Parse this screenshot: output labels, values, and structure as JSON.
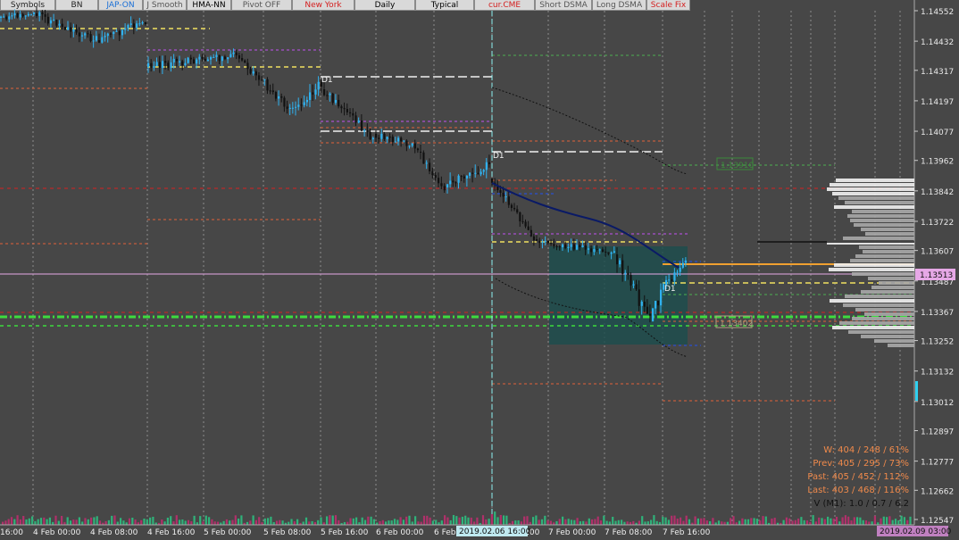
{
  "toolbar": [
    {
      "key": "symbols",
      "label": "Symbols",
      "color": "#222222"
    },
    {
      "key": "bn",
      "label": "BN",
      "color": "#222222"
    },
    {
      "key": "jap_on",
      "label": "JAP-ON",
      "color": "#1a6fd6"
    },
    {
      "key": "j_smooth",
      "label": "J Smooth",
      "color": "#555555"
    },
    {
      "key": "hma_nn",
      "label": "HMA-NN",
      "color": "#000000"
    },
    {
      "key": "pivot_off",
      "label": "Pivot OFF",
      "color": "#555555"
    },
    {
      "key": "new_york",
      "label": "New York",
      "color": "#d42020"
    },
    {
      "key": "daily",
      "label": "Daily",
      "color": "#000000"
    },
    {
      "key": "typical",
      "label": "Typical",
      "color": "#000000"
    },
    {
      "key": "cur_cme",
      "label": "cur.CME",
      "color": "#d42020"
    },
    {
      "key": "short_dsma",
      "label": "Short DSMA",
      "color": "#555555"
    },
    {
      "key": "long_dsma",
      "label": "Long DSMA",
      "color": "#555555"
    },
    {
      "key": "scale_fix",
      "label": "Scale Fix",
      "color": "#d42020"
    }
  ],
  "price_axis": {
    "ticks": [
      "1.14552",
      "1.14432",
      "1.14317",
      "1.14197",
      "1.14077",
      "1.13962",
      "1.13842",
      "1.13722",
      "1.13607",
      "1.13487",
      "1.13367",
      "1.13252",
      "1.13132",
      "1.13012",
      "1.12897",
      "1.12777",
      "1.12662",
      "1.12547"
    ],
    "current_price": "1.13513",
    "label_a": "1.13910",
    "label_b": "1.13402"
  },
  "time_axis": {
    "labels": [
      "16:00",
      "4 Feb 00:00",
      "4 Feb 08:00",
      "4 Feb 16:00",
      "5 Feb 00:00",
      "5 Feb 08:00",
      "5 Feb 16:00",
      "6 Feb 00:00",
      "6 Feb 08:00",
      "6 Feb 16:00",
      "7 Feb 00:00",
      "7 Feb 08:00",
      "7 Feb 16:00"
    ],
    "crosshair_time": "2019.02.06 16:00",
    "right_time": "2019.02.09 03:00"
  },
  "markers": {
    "d1": "D1"
  },
  "stats": {
    "w": "W: 404 / 248 / 61%",
    "prev": "Prev: 405 / 295 / 73%",
    "past": "Past: 405 / 452 / 112%",
    "last": "Last: 403 / 468 / 116%",
    "v": "V (M1): 1.0 / 0.7 / 6.2"
  },
  "colors": {
    "background": "#474747",
    "bull": "#2fb2f0",
    "bear": "#111111",
    "highlight": "#1f4e4e",
    "current_line": "#e6a8e6"
  }
}
